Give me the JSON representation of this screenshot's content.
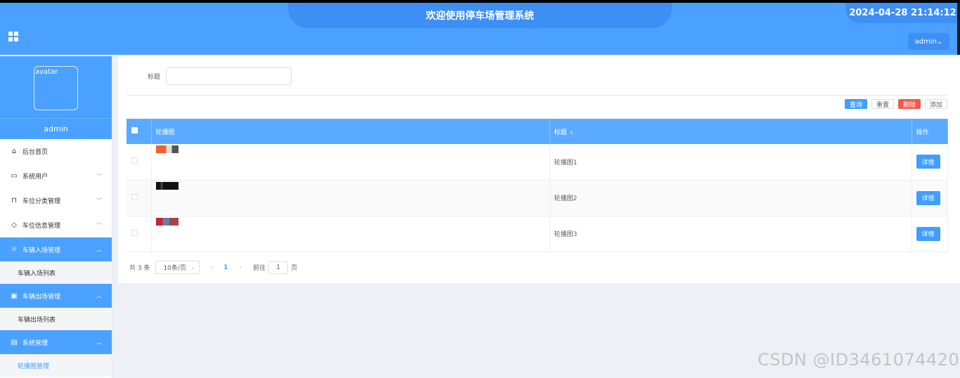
{
  "header": {
    "title": "欢迎使用停车场管理系统",
    "datetime": "2024-04-28 21:14:12",
    "user_menu": "admin"
  },
  "sidebar": {
    "avatar_alt": "avatar",
    "username": "admin",
    "items": [
      {
        "label": "后台首页",
        "icon": "home-icon"
      },
      {
        "label": "系统用户",
        "icon": "monitor-icon"
      },
      {
        "label": "车位分类管理",
        "icon": "bookmark-icon"
      },
      {
        "label": "车位信息管理",
        "icon": "tag-icon"
      },
      {
        "label": "车辆入场管理",
        "icon": "sun-icon",
        "sub": "车辆入场列表"
      },
      {
        "label": "车辆出场管理",
        "icon": "box-icon",
        "sub": "车辆出场列表"
      },
      {
        "label": "系统管理",
        "icon": "clipboard-icon",
        "sub": "轮播图管理"
      }
    ]
  },
  "search": {
    "label": "标题",
    "value": ""
  },
  "actions": {
    "query": "查询",
    "reset": "重置",
    "delete": "删除",
    "add": "添加"
  },
  "table": {
    "columns": [
      "轮播图",
      "标题",
      "操作"
    ],
    "rows": [
      {
        "title": "轮播图1",
        "action": "详情"
      },
      {
        "title": "轮播图2",
        "action": "详情"
      },
      {
        "title": "轮播图3",
        "action": "详情"
      }
    ]
  },
  "pager": {
    "total": "共 3 条",
    "page_size": "10条/页",
    "current": "1",
    "goto_label": "前往",
    "goto_value": "1",
    "page_suffix": "页"
  },
  "watermark": "CSDN @ID3461074420",
  "colors": {
    "primary": "#4aa1ff",
    "danger": "#f05b4f"
  }
}
